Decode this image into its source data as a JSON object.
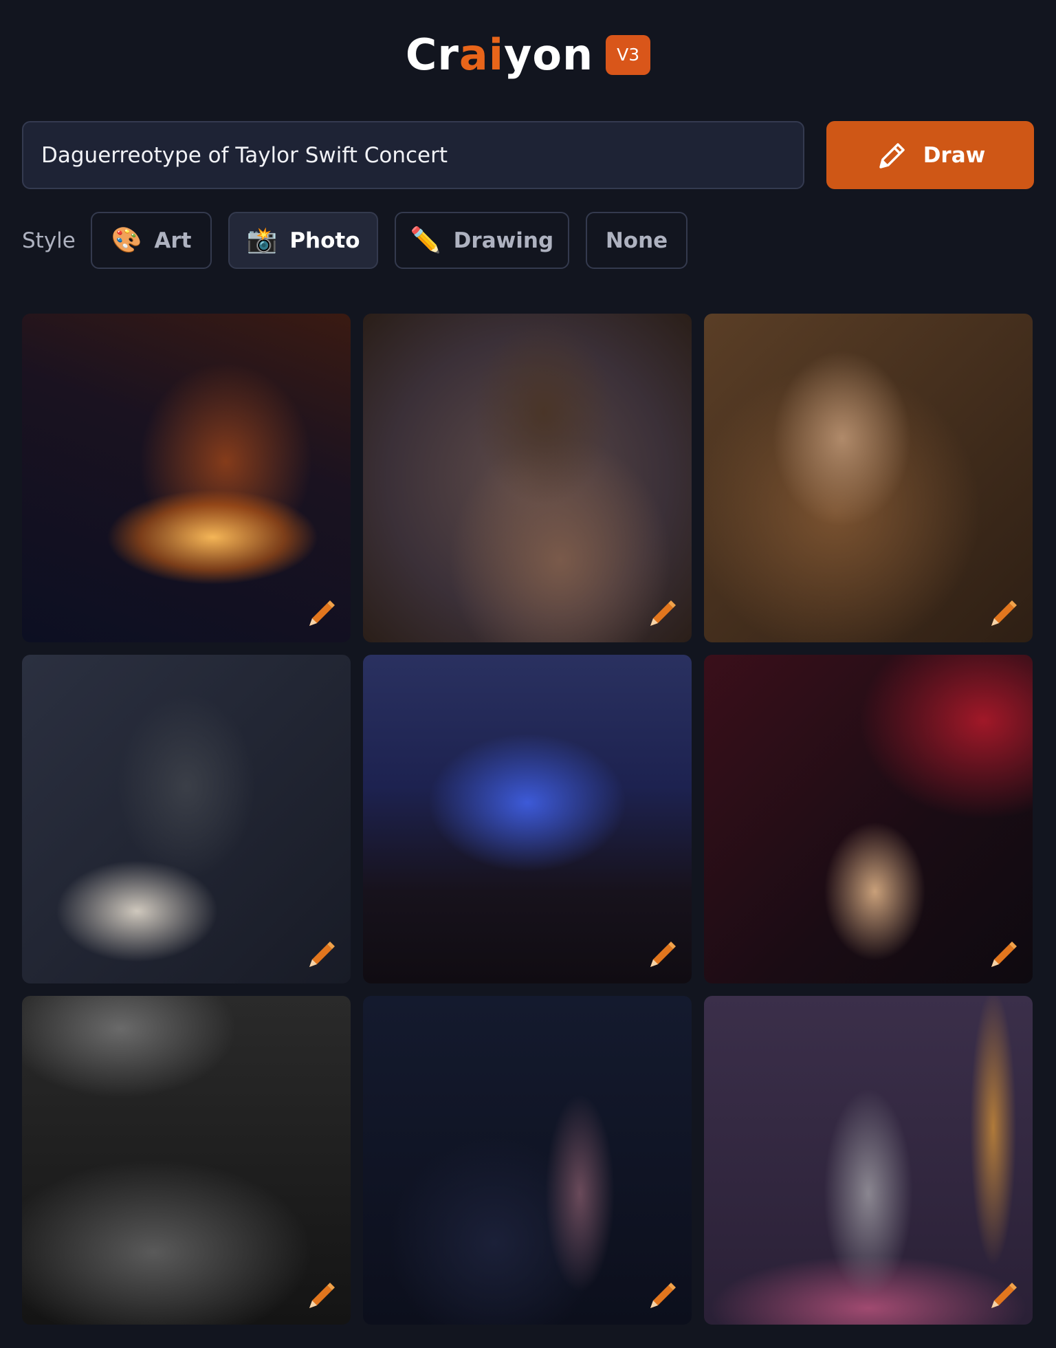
{
  "header": {
    "logo_part1": "Cr",
    "logo_part2": "ai",
    "logo_part3": "yon",
    "version": "V3"
  },
  "search": {
    "value": "Daguerreotype of Taylor Swift Concert",
    "draw_label": "Draw"
  },
  "style": {
    "label": "Style",
    "options": [
      {
        "emoji": "🎨",
        "label": "Art",
        "selected": false
      },
      {
        "emoji": "📸",
        "label": "Photo",
        "selected": true
      },
      {
        "emoji": "✏️",
        "label": "Drawing",
        "selected": false
      },
      {
        "emoji": "",
        "label": "None",
        "selected": false
      }
    ]
  },
  "results": {
    "count": 9,
    "edit_icon": "pencil-icon"
  },
  "colors": {
    "accent": "#cf5716",
    "background": "#12151f",
    "input_bg": "#1e2335"
  }
}
